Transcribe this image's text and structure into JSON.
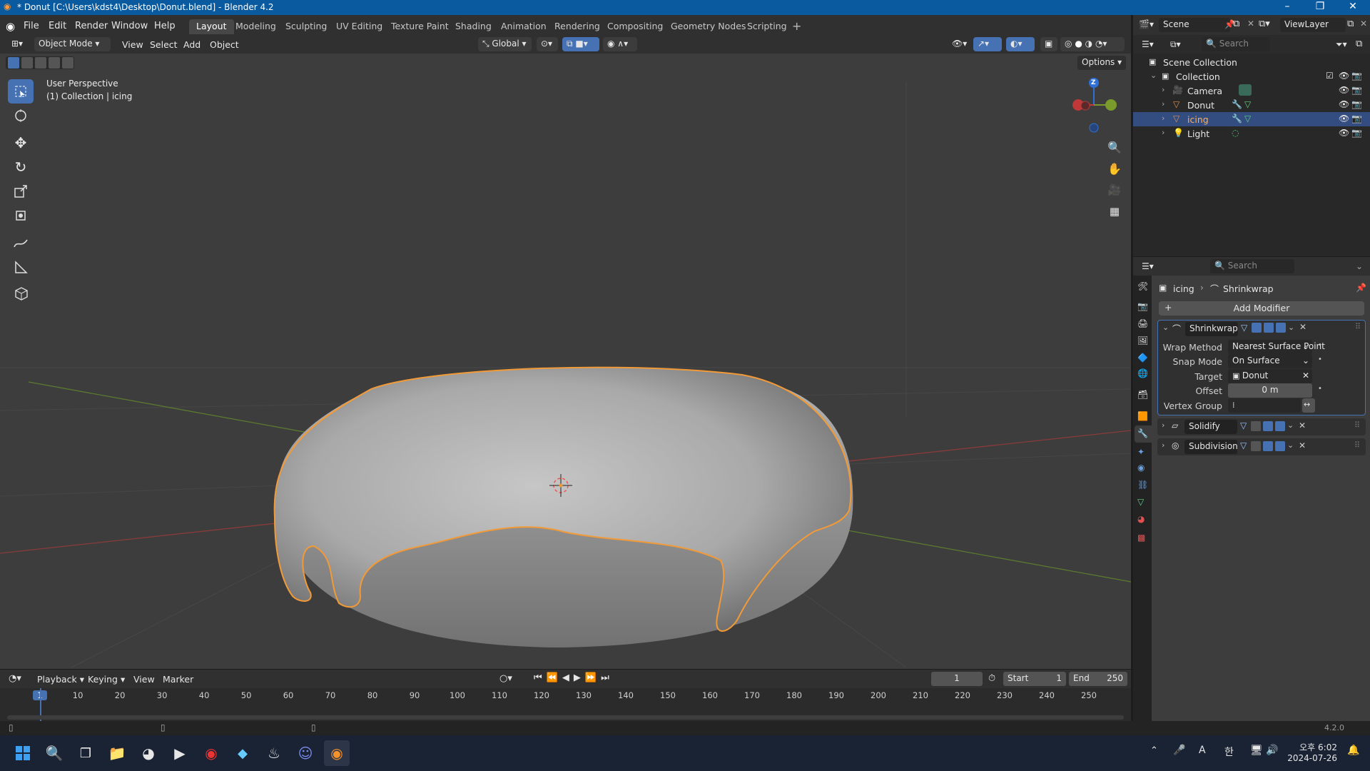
{
  "window": {
    "title": "* Donut [C:\\Users\\kdst4\\Desktop\\Donut.blend] - Blender 4.2"
  },
  "menus": [
    "File",
    "Edit",
    "Render",
    "Window",
    "Help"
  ],
  "workspaces": [
    "Layout",
    "Modeling",
    "Sculpting",
    "UV Editing",
    "Texture Paint",
    "Shading",
    "Animation",
    "Rendering",
    "Compositing",
    "Geometry Nodes",
    "Scripting"
  ],
  "active_workspace": "Layout",
  "scene": {
    "label": "Scene",
    "view_layer": "ViewLayer"
  },
  "viewport_header": {
    "mode": "Object Mode",
    "menus": [
      "View",
      "Select",
      "Add",
      "Object"
    ],
    "orientation": "Global",
    "options_label": "Options"
  },
  "viewport": {
    "perspective": "User Perspective",
    "context": "(1) Collection | icing",
    "gizmo_axis": "Z"
  },
  "outliner": {
    "search_placeholder": "Search",
    "root": "Scene Collection",
    "collection": "Collection",
    "items": [
      {
        "name": "Camera",
        "selected": false
      },
      {
        "name": "Donut",
        "selected": false
      },
      {
        "name": "icing",
        "selected": true
      },
      {
        "name": "Light",
        "selected": false
      }
    ]
  },
  "properties": {
    "search_placeholder": "Search",
    "breadcrumb": {
      "object": "icing",
      "modifier": "Shrinkwrap"
    },
    "add_modifier": "Add Modifier",
    "modifiers": [
      {
        "name": "Shrinkwrap",
        "expanded": true
      },
      {
        "name": "Solidify",
        "expanded": false
      },
      {
        "name": "Subdivision",
        "expanded": false
      }
    ],
    "shrinkwrap": {
      "wrap_method_label": "Wrap Method",
      "wrap_method_value": "Nearest Surface Point",
      "snap_mode_label": "Snap Mode",
      "snap_mode_value": "On Surface",
      "target_label": "Target",
      "target_value": "Donut",
      "offset_label": "Offset",
      "offset_value": "0 m",
      "vertex_group_label": "Vertex Group",
      "vertex_group_value": ""
    }
  },
  "timeline": {
    "menus": [
      "Playback",
      "Keying",
      "View",
      "Marker"
    ],
    "current_frame": "1",
    "start_label": "Start",
    "start_value": "1",
    "end_label": "End",
    "end_value": "250",
    "ruler": [
      "1",
      "10",
      "20",
      "30",
      "40",
      "50",
      "60",
      "70",
      "80",
      "90",
      "100",
      "110",
      "120",
      "130",
      "140",
      "150",
      "160",
      "170",
      "180",
      "190",
      "200",
      "210",
      "220",
      "230",
      "240",
      "250"
    ]
  },
  "statusbar": {
    "version": "4.2.0"
  },
  "taskbar": {
    "am_pm": "오후",
    "time": "6:02",
    "date": "2024-07-26",
    "ime_a": "A",
    "ime_han": "한"
  },
  "colors": {
    "accent": "#4672b4",
    "selection_outline": "#f29a37",
    "title_bar": "#0a5aa0"
  }
}
